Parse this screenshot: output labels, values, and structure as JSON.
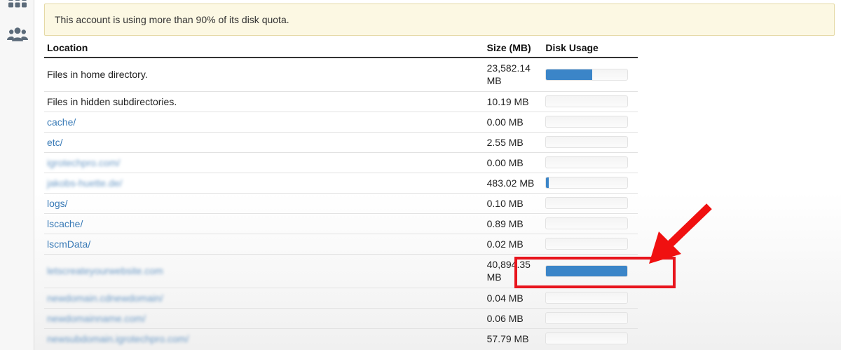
{
  "colors": {
    "accent": "#3b85c8",
    "link": "#3a7bb7",
    "highlight": "#e8141c",
    "alert_bg": "#fcf8e3"
  },
  "sidebar": {
    "icons": [
      "grid-icon",
      "users-icon"
    ]
  },
  "alert": {
    "message": "This account is using more than 90% of its disk quota."
  },
  "table": {
    "headers": {
      "location": "Location",
      "size": "Size (MB)",
      "usage": "Disk Usage"
    },
    "rows": [
      {
        "location": "Files in home directory.",
        "size": "23,582.14 MB",
        "usage_percent": 57,
        "link": false,
        "blurred": false
      },
      {
        "location": "Files in hidden subdirectories.",
        "size": "10.19 MB",
        "usage_percent": 0,
        "link": false,
        "blurred": false
      },
      {
        "location": "cache/",
        "size": "0.00 MB",
        "usage_percent": 0,
        "link": true,
        "blurred": false
      },
      {
        "location": "etc/",
        "size": "2.55 MB",
        "usage_percent": 0,
        "link": true,
        "blurred": false
      },
      {
        "location": "igrotechpro.com/",
        "size": "0.00 MB",
        "usage_percent": 0,
        "link": true,
        "blurred": true
      },
      {
        "location": "jakobs-huette.de/",
        "size": "483.02 MB",
        "usage_percent": 3,
        "link": true,
        "blurred": true
      },
      {
        "location": "logs/",
        "size": "0.10 MB",
        "usage_percent": 0,
        "link": true,
        "blurred": false
      },
      {
        "location": "lscache/",
        "size": "0.89 MB",
        "usage_percent": 0,
        "link": true,
        "blurred": false
      },
      {
        "location": "lscmData/",
        "size": "0.02 MB",
        "usage_percent": 0,
        "link": true,
        "blurred": false
      },
      {
        "location": "letscreateyourwebsite.com",
        "size": "40,894.35 MB",
        "usage_percent": 100,
        "link": true,
        "blurred": true
      },
      {
        "location": "newdomain.cdnewdomain/",
        "size": "0.04 MB",
        "usage_percent": 0,
        "link": true,
        "blurred": true
      },
      {
        "location": "newdomainname.com/",
        "size": "0.06 MB",
        "usage_percent": 0,
        "link": true,
        "blurred": true
      },
      {
        "location": "newsubdomain.igrotechpro.com/",
        "size": "57.79 MB",
        "usage_percent": 0,
        "link": true,
        "blurred": true
      }
    ]
  }
}
